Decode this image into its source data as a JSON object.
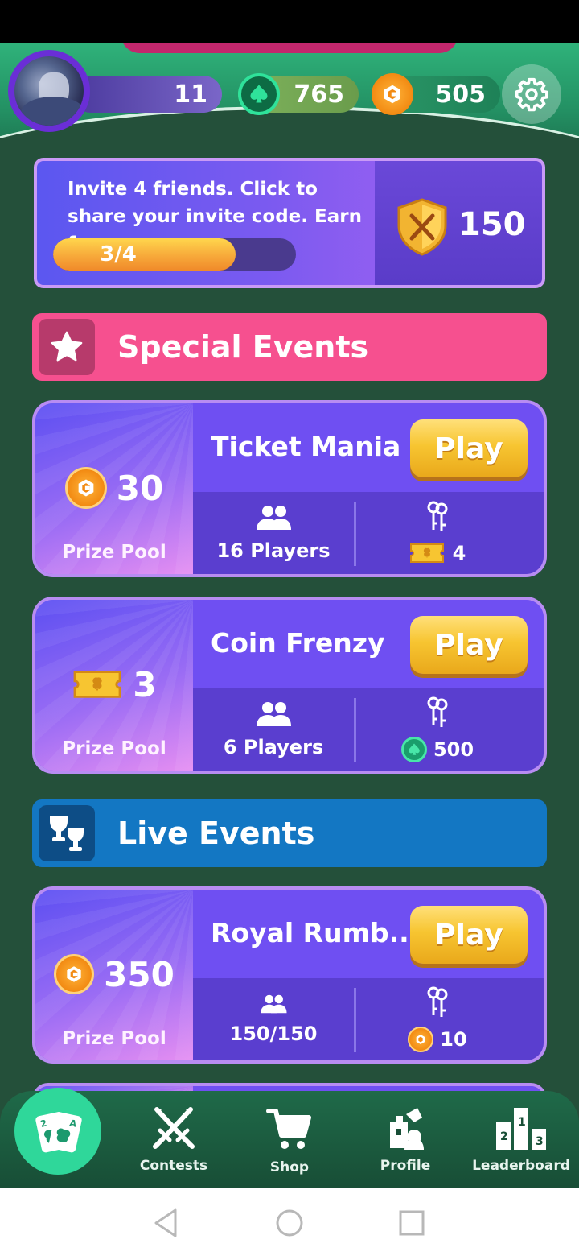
{
  "header": {
    "level": "11",
    "spades": "765",
    "coins": "505"
  },
  "invite": {
    "text": "Invite 4 friends. Click to share your invite code. Earn for",
    "progress_label": "3/4",
    "progress_value": 0.75,
    "reward": "150"
  },
  "sections": {
    "special": "Special Events",
    "live": "Live Events"
  },
  "events": [
    {
      "name": "Ticket Mania",
      "prize": "30",
      "prize_label": "Prize Pool",
      "players": "16 Players",
      "entry": "4",
      "play": "Play"
    },
    {
      "name": "Coin Frenzy",
      "prize": "3",
      "prize_label": "Prize Pool",
      "players": "6 Players",
      "entry": "500",
      "play": "Play"
    },
    {
      "name": "Royal Rumb...",
      "prize": "350",
      "prize_label": "Prize Pool",
      "players": "150/150",
      "entry": "10",
      "play": "Play"
    }
  ],
  "nav": {
    "contests": "Contests",
    "shop": "Shop",
    "profile": "Profile",
    "leaderboard": "Leaderboard"
  },
  "colors": {
    "background": "#24503a",
    "accent_pink": "#f6508f",
    "accent_blue": "#1377c3",
    "play_yellow": "#f7c531",
    "card_purple": "#6a52e8"
  }
}
